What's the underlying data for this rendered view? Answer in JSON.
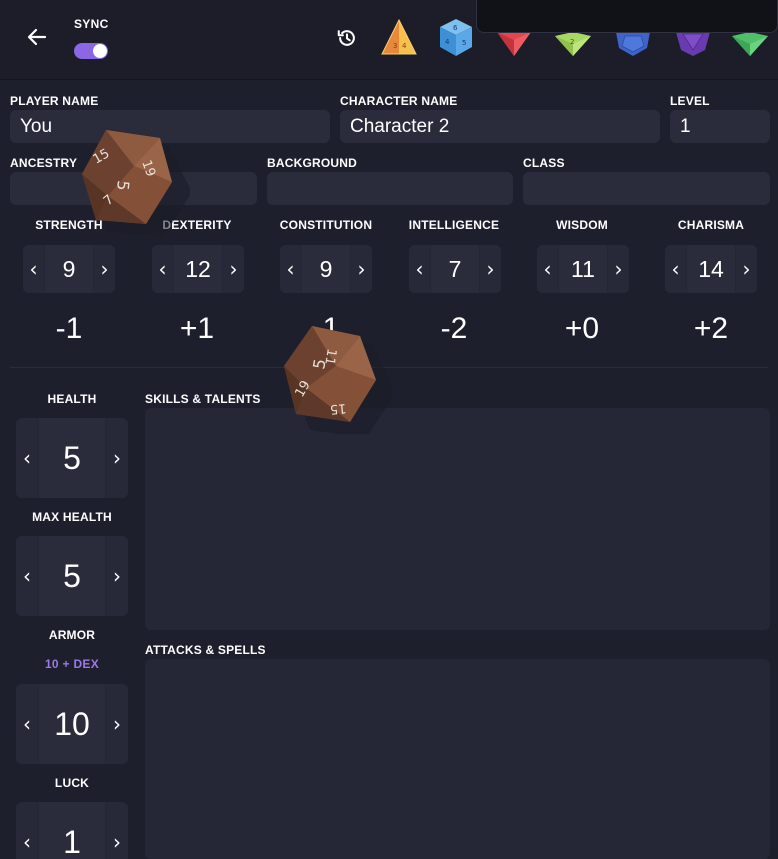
{
  "header": {
    "sync_label": "SYNC",
    "sync_enabled": true,
    "dice": [
      {
        "name": "d4",
        "color": "#f2a23c",
        "face": "3 4"
      },
      {
        "name": "d6",
        "color": "#4f9fe0",
        "face": "6"
      },
      {
        "name": "d8",
        "color": "#e2474f",
        "face": ""
      },
      {
        "name": "d10",
        "color": "#9ed15c",
        "face": "2"
      },
      {
        "name": "d12",
        "color": "#3e64c8",
        "face": ""
      },
      {
        "name": "d20",
        "color": "#6a3bb0",
        "face": ""
      },
      {
        "name": "d100",
        "color": "#4fbf6a",
        "face": ""
      }
    ]
  },
  "info": {
    "player_name_label": "PLAYER NAME",
    "player_name": "You",
    "character_name_label": "CHARACTER NAME",
    "character_name": "Character 2",
    "level_label": "LEVEL",
    "level": "1",
    "ancestry_label": "ANCESTRY",
    "ancestry": "",
    "background_label": "BACKGROUND",
    "background": "",
    "class_label": "CLASS",
    "class": ""
  },
  "stats": [
    {
      "name": "STRENGTH",
      "value": "9",
      "mod": "-1"
    },
    {
      "name": "DEXTERITY",
      "value": "12",
      "mod": "+1"
    },
    {
      "name": "CONSTITUTION",
      "value": "9",
      "mod": "-1"
    },
    {
      "name": "INTELLIGENCE",
      "value": "7",
      "mod": "-2"
    },
    {
      "name": "WISDOM",
      "value": "11",
      "mod": "+0"
    },
    {
      "name": "CHARISMA",
      "value": "14",
      "mod": "+2"
    }
  ],
  "vitals": {
    "health_label": "HEALTH",
    "health": "5",
    "max_health_label": "MAX HEALTH",
    "max_health": "5",
    "armor_label": "ARMOR",
    "armor_formula": "10 + DEX",
    "armor": "10",
    "luck_label": "LUCK",
    "luck": "1"
  },
  "sections": {
    "skills_label": "SKILLS & TALENTS",
    "attacks_label": "ATTACKS & SPELLS"
  },
  "stepper": {
    "left_arrow": "‹",
    "right_arrow": "›"
  },
  "rolled_dice": [
    {
      "faces": [
        "15",
        "19",
        "5",
        "7"
      ]
    },
    {
      "faces": [
        "11",
        "5",
        "19",
        "15"
      ]
    }
  ],
  "colors": {
    "accent": "#8b67e6",
    "armor_formula": "#9b78e8",
    "background": "#1e1f2c",
    "field": "#2a2c3c"
  }
}
